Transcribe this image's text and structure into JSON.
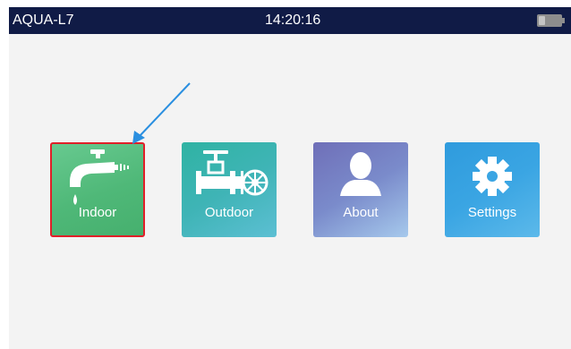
{
  "statusbar": {
    "title": "AQUA-L7",
    "clock": "14:20:16",
    "battery_level": 0.3
  },
  "tiles": [
    {
      "label": "Indoor",
      "icon": "faucet-icon",
      "selected": true
    },
    {
      "label": "Outdoor",
      "icon": "valve-icon"
    },
    {
      "label": "About",
      "icon": "user-icon"
    },
    {
      "label": "Settings",
      "icon": "gear-icon"
    }
  ],
  "colors": {
    "statusbar_bg": "#101b46",
    "screen_bg": "#f3f3f3",
    "selection_border": "#e01f28",
    "pointer_arrow": "#2a8fe0",
    "indoor": "#4fb878",
    "outdoor": "#3fb4b6",
    "about": "#7a8bcb",
    "settings": "#3aa5e3"
  }
}
